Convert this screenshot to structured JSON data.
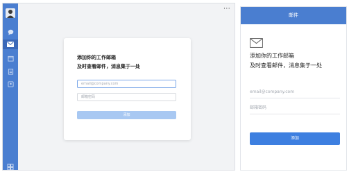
{
  "main_window": {
    "more_button": "···",
    "card": {
      "title_line1": "添加你的工作邮箱",
      "title_line2": "及时查看邮件，消息集于一处",
      "email_placeholder": "email@company.com",
      "password_placeholder": "邮箱密码",
      "add_button": "添加"
    },
    "sidebar": {
      "icons": [
        "avatar",
        "chat-icon",
        "mail-icon",
        "calendar-icon",
        "docs-icon",
        "contacts-icon",
        "apps-icon"
      ],
      "active": "mail-icon"
    }
  },
  "mail_panel": {
    "header_title": "邮件",
    "title_line1": "添加你的工作邮箱",
    "title_line2": "及时查看邮件，消息集于一处",
    "email_placeholder": "email@company.com",
    "password_placeholder": "邮箱密码",
    "add_button": "添加"
  }
}
